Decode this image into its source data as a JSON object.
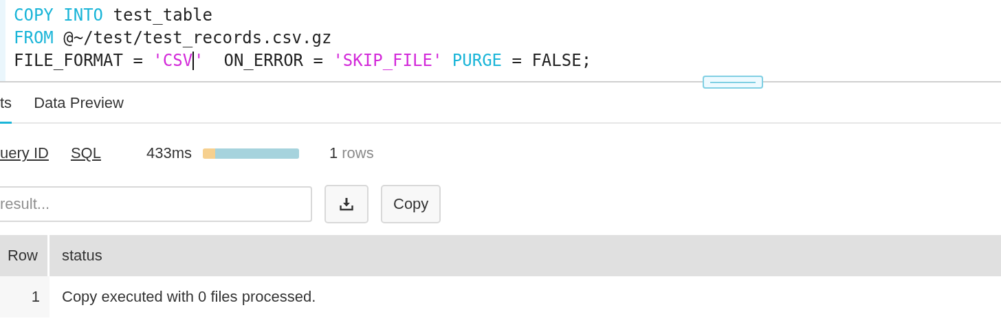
{
  "editor": {
    "lines": [
      [
        {
          "text": "COPY",
          "kind": "keyword"
        },
        {
          "text": " INTO",
          "kind": "keyword"
        },
        {
          "text": " test_table",
          "kind": "plain"
        }
      ],
      [
        {
          "text": "FROM",
          "kind": "keyword"
        },
        {
          "text": " @~/test/test_records.csv.gz",
          "kind": "plain"
        }
      ],
      [
        {
          "text": "FILE_FORMAT = ",
          "kind": "plain"
        },
        {
          "text": "'CSV",
          "kind": "string",
          "cursor_after": true
        },
        {
          "text": "'",
          "kind": "string"
        },
        {
          "text": "  ON_ERROR = ",
          "kind": "plain"
        },
        {
          "text": "'SKIP_FILE'",
          "kind": "string"
        },
        {
          "text": " PURGE",
          "kind": "keyword"
        },
        {
          "text": " = FALSE;",
          "kind": "plain"
        }
      ]
    ]
  },
  "tabs": [
    {
      "label": "ts",
      "selected": true
    },
    {
      "label": "Data Preview",
      "selected": false
    }
  ],
  "info": {
    "links": [
      "uery ID",
      "SQL"
    ],
    "duration": "433ms",
    "timing": [
      {
        "level": 0.13,
        "color": "#f6d08f"
      },
      {
        "level": 0.87,
        "color": "#a6d3dd"
      }
    ],
    "row_count": "1",
    "row_unit": "rows"
  },
  "search": {
    "placeholder": "result..."
  },
  "buttons": [
    {
      "kind": "download"
    },
    {
      "kind": "text",
      "label": "Copy"
    }
  ],
  "table": {
    "columns": [
      "Row",
      "status"
    ],
    "rows": [
      [
        "1",
        "Copy executed with 0 files processed."
      ]
    ]
  }
}
